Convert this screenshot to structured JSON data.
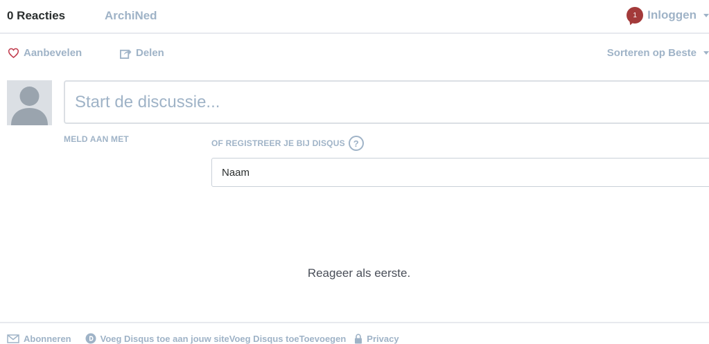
{
  "nav": {
    "comment_count": "0 Reacties",
    "site_name": "ArchiNed",
    "notification_count": "1",
    "login_label": "Inloggen"
  },
  "actions": {
    "recommend_label": "Aanbevelen",
    "share_label": "Delen",
    "sort_label": "Sorteren op Beste"
  },
  "composer": {
    "placeholder": "Start de discussie..."
  },
  "login_options": {
    "social_label": "MELD AAN MET",
    "register_label": "OF REGISTREER JE BIJ DISQUS",
    "help_symbol": "?",
    "name_placeholder": "Naam"
  },
  "empty_message": "Reageer als eerste.",
  "footer": {
    "subscribe_label": "Abonneren",
    "add_disqus_label": "Voeg Disqus toe aan jouw siteVoeg Disqus toeToevoegen",
    "privacy_label": "Privacy"
  },
  "colors": {
    "accent_text": "#9fb3c7",
    "badge": "#a33a3a",
    "heart": "#c0394b"
  }
}
